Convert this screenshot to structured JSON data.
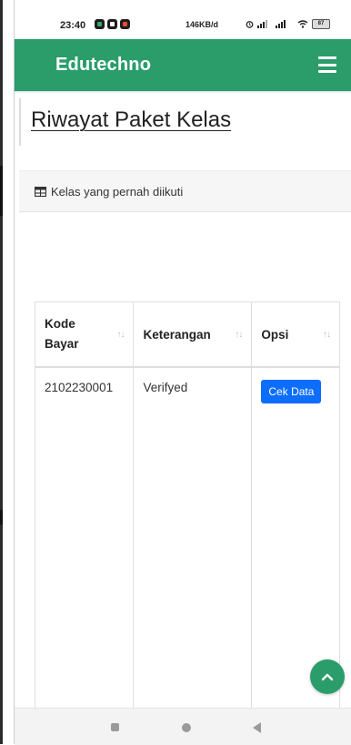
{
  "status_bar": {
    "time": "23:40",
    "network_speed": "146KB/d",
    "battery": "87",
    "icons": [
      "app-icon",
      "app-icon",
      "app-icon",
      "alarm-icon",
      "signal-icon",
      "signal-icon",
      "wifi-icon",
      "battery-icon"
    ]
  },
  "header": {
    "brand": "Edutechno",
    "menu_icon": "hamburger-menu-icon",
    "brand_color": "#2a9d6b"
  },
  "page": {
    "title": "Riwayat Paket Kelas"
  },
  "card": {
    "icon": "table-icon",
    "title": "Kelas yang pernah diikuti"
  },
  "table": {
    "headers": [
      {
        "label": "Kode Bayar",
        "sort_icon": "sort-icon"
      },
      {
        "label": "Keterangan",
        "sort_icon": "sort-icon"
      },
      {
        "label": "Opsi",
        "sort_icon": "sort-icon"
      }
    ],
    "rows": [
      {
        "kode_bayar": "2102230001",
        "keterangan": "Verifyed",
        "action_label": "Cek Data"
      }
    ],
    "action_color": "#0d6efd"
  },
  "scroll_top": {
    "icon": "chevron-up-icon"
  },
  "nav_bar": {
    "icons": [
      "recent-apps-icon",
      "home-icon",
      "back-icon"
    ]
  }
}
